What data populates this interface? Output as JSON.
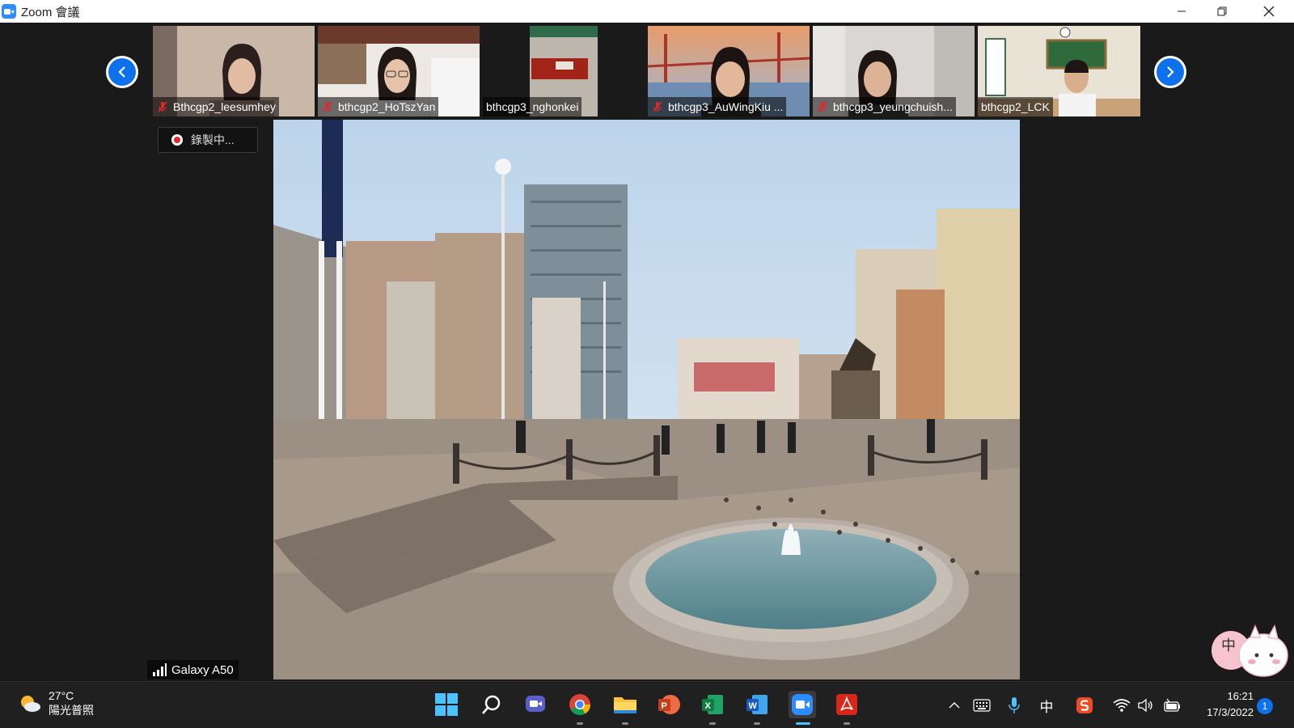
{
  "window": {
    "title": "Zoom 會議",
    "app_icon": "zoom-camera-icon",
    "controls": [
      "minimize-icon",
      "restore-icon",
      "close-icon"
    ]
  },
  "gallery": {
    "prev_icon": "chevron-left-icon",
    "next_icon": "chevron-right-icon",
    "participants": [
      {
        "name": "Bthcgp2_leesumhey",
        "muted": true
      },
      {
        "name": "bthcgp2_HoTszYan",
        "muted": true
      },
      {
        "name": "bthcgp3_nghonkei",
        "muted": false
      },
      {
        "name": "bthcgp3_AuWingKiu ...",
        "muted": true
      },
      {
        "name": "bthcgp3_yeungchuish...",
        "muted": true
      },
      {
        "name": "bthcgp2_LCK",
        "muted": false
      }
    ]
  },
  "recording": {
    "label": "錄製中..."
  },
  "speaker": {
    "device_label": "Galaxy A50",
    "signal_icon": "signal-bars-icon"
  },
  "taskbar": {
    "weather": {
      "temp": "27°C",
      "condition": "陽光普照",
      "icon": "sun-cloud-icon"
    },
    "apps": [
      "windows-start-icon",
      "search-icon",
      "teams-chat-icon",
      "chrome-icon",
      "file-explorer-icon",
      "powerpoint-icon",
      "excel-icon",
      "word-icon",
      "zoom-icon",
      "acrobat-icon"
    ],
    "tray": {
      "ime_label": "中",
      "icons": [
        "chevron-up-icon",
        "keyboard-icon",
        "microphone-icon",
        "ime-icon",
        "sogou-icon",
        "wifi-icon",
        "volume-icon",
        "battery-icon"
      ]
    },
    "time": "16:21",
    "date": "17/3/2022",
    "notification_count": "1"
  },
  "sticker": {
    "label": "中"
  },
  "colors": {
    "zoom_blue": "#0e71eb",
    "muted_red": "#e02828",
    "background": "#1a1a1a"
  }
}
